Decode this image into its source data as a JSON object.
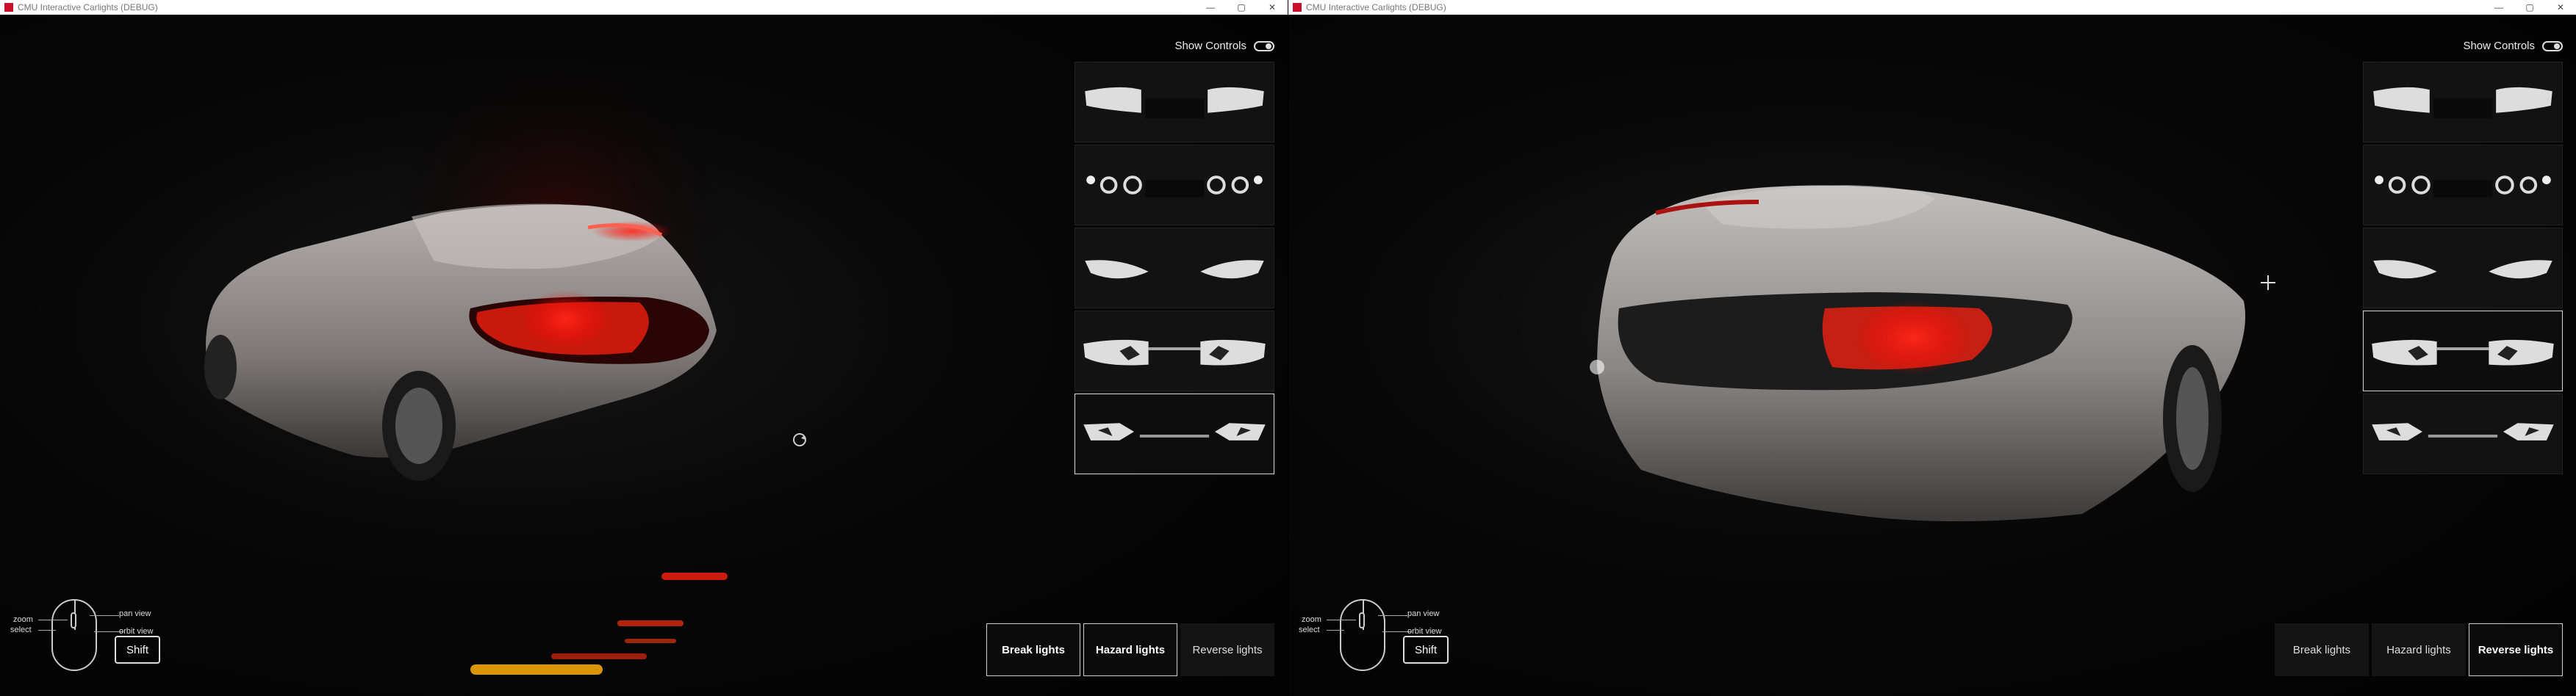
{
  "windows": [
    {
      "title": "CMU Interactive Carlights (DEBUG)",
      "show_controls_label": "Show Controls",
      "selected_thumb": 4,
      "buttons": [
        {
          "label": "Break lights",
          "active": true
        },
        {
          "label": "Hazard lights",
          "active": true
        },
        {
          "label": "Reverse lights",
          "active": false
        }
      ],
      "mouse_help": {
        "zoom": "zoom",
        "select": "select",
        "pan": "pan view",
        "orbit": "orbit view",
        "shift": "Shift"
      },
      "cursor_icon": "rotate-icon"
    },
    {
      "title": "CMU Interactive Carlights (DEBUG)",
      "show_controls_label": "Show Controls",
      "selected_thumb": 3,
      "buttons": [
        {
          "label": "Break lights",
          "active": false
        },
        {
          "label": "Hazard lights",
          "active": false
        },
        {
          "label": "Reverse lights",
          "active": true
        }
      ],
      "mouse_help": {
        "zoom": "zoom",
        "select": "select",
        "pan": "pan view",
        "orbit": "orbit view",
        "shift": "Shift"
      },
      "cursor_icon": "crosshair-icon"
    }
  ],
  "window_controls": {
    "minimize": "—",
    "maximize": "▢",
    "close": "✕"
  },
  "colors": {
    "light_red": "#ff1a1a",
    "light_amber": "#ffb000",
    "car_body": "#9a9a9a"
  }
}
